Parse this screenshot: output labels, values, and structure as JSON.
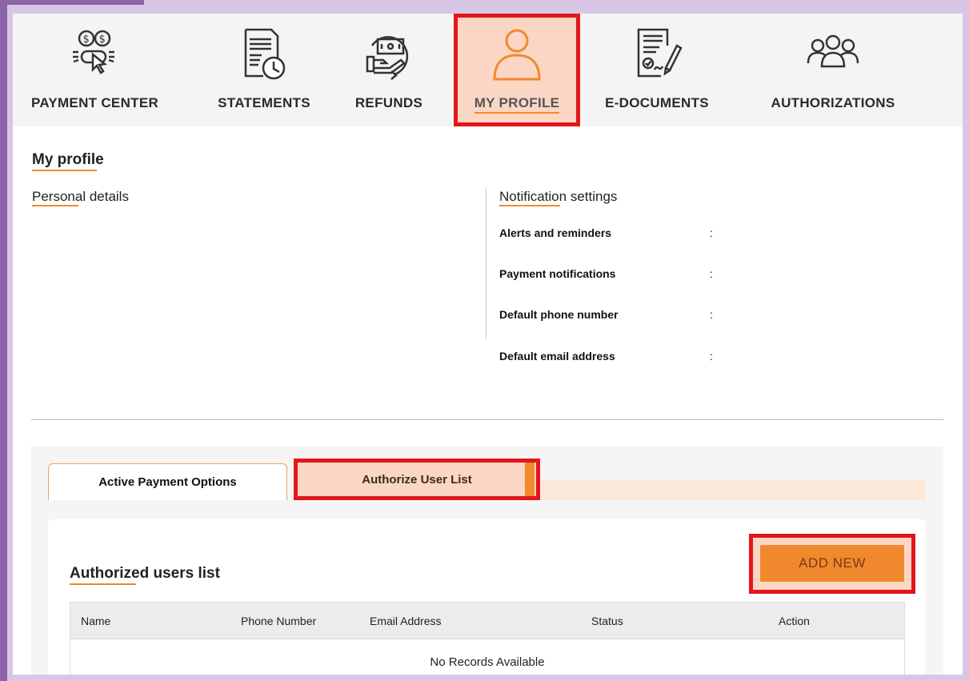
{
  "nav": {
    "items": [
      {
        "label": "PAYMENT CENTER",
        "icon": "payment-icon"
      },
      {
        "label": "STATEMENTS",
        "icon": "statement-clock-icon"
      },
      {
        "label": "REFUNDS",
        "icon": "refund-hand-icon"
      },
      {
        "label": "MY PROFILE",
        "icon": "user-profile-icon",
        "active": true
      },
      {
        "label": "E-DOCUMENTS",
        "icon": "document-sign-icon"
      },
      {
        "label": "AUTHORIZATIONS",
        "icon": "group-users-icon"
      }
    ]
  },
  "profile": {
    "title": "My profile",
    "personal_title": "Personal details",
    "notification_title": "Notification settings",
    "notifications": [
      {
        "label": "Alerts and reminders",
        "sep": ":"
      },
      {
        "label": "Payment notifications",
        "sep": ":"
      },
      {
        "label": "Default phone number",
        "sep": ":"
      },
      {
        "label": "Default email address",
        "sep": ":"
      }
    ]
  },
  "tabs": [
    {
      "label": "Active Payment Options"
    },
    {
      "label": "Authorize User List",
      "active": true
    }
  ],
  "users": {
    "title": "Authorized users list",
    "add_label": "ADD NEW",
    "columns": [
      "Name",
      "Phone Number",
      "Email Address",
      "Status",
      "Action"
    ],
    "empty_text": "No Records Available"
  },
  "colors": {
    "accent": "#f08a2c",
    "highlight": "#e2161b",
    "active_bg": "#fbd6c5"
  }
}
